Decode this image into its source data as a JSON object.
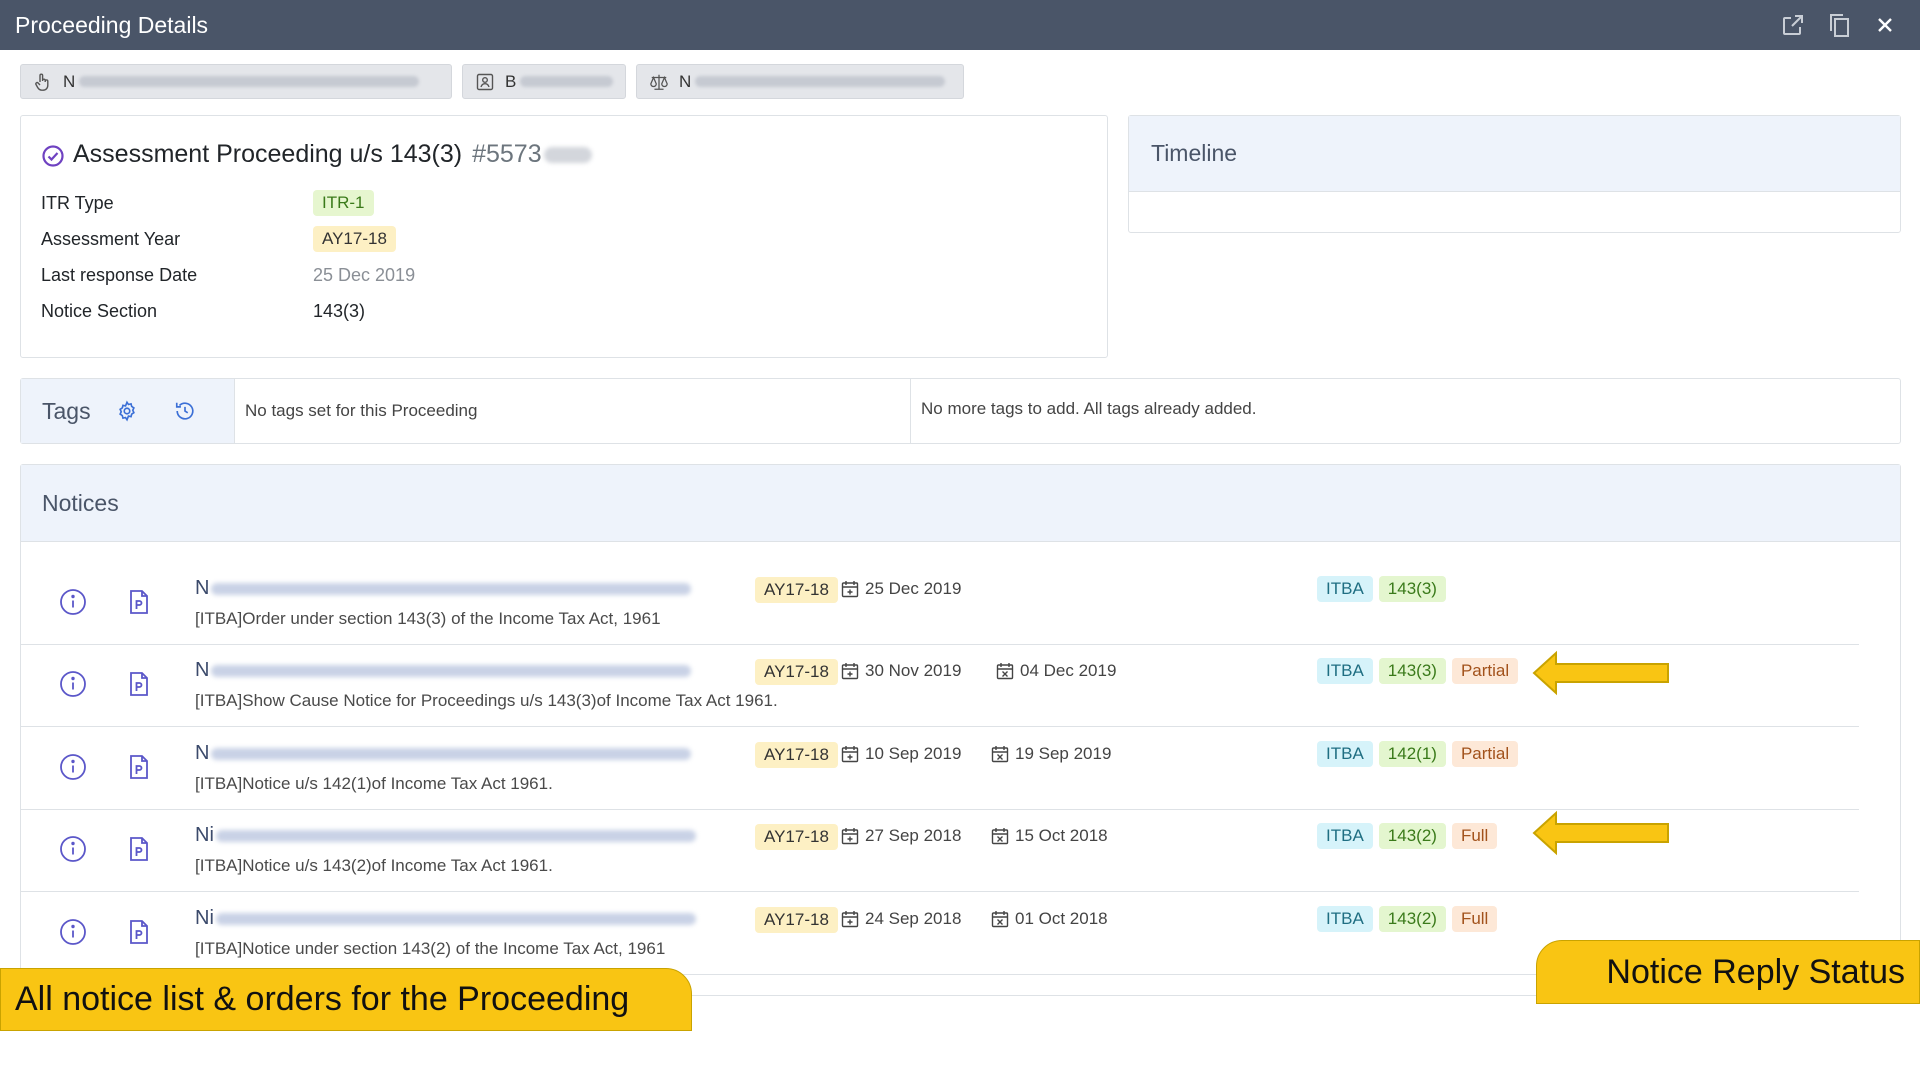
{
  "window": {
    "title": "Proceeding Details"
  },
  "chips": [
    {
      "icon": "hand-pointer-icon",
      "visible_text": "N"
    },
    {
      "icon": "id-card-icon",
      "visible_text": "B"
    },
    {
      "icon": "balance-scale-icon",
      "visible_text": "N"
    }
  ],
  "proceeding": {
    "title": "Assessment Proceeding u/s 143(3)",
    "id_visible": "#5573",
    "fields": {
      "itr_type_label": "ITR Type",
      "itr_type_value": "ITR-1",
      "ay_label": "Assessment Year",
      "ay_value": "AY17-18",
      "last_response_label": "Last response Date",
      "last_response_value": "25 Dec 2019",
      "notice_section_label": "Notice Section",
      "notice_section_value": "143(3)"
    }
  },
  "timeline": {
    "title": "Timeline"
  },
  "tags": {
    "title": "Tags",
    "current_text": "No tags set for this Proceeding",
    "available_text": "No more tags to add. All tags already added."
  },
  "notices": {
    "title": "Notices",
    "items": [
      {
        "name_visible": "N",
        "desc": "[ITBA]Order under section 143(3) of the Income Tax Act, 1961",
        "ay": "AY17-18",
        "issued": "25 Dec 2019",
        "due": null,
        "source": "ITBA",
        "section": "143(3)",
        "status": null
      },
      {
        "name_visible": "N",
        "desc": "[ITBA]Show Cause Notice for Proceedings u/s 143(3)of Income Tax Act 1961.",
        "ay": "AY17-18",
        "issued": "30 Nov 2019",
        "due": "04 Dec 2019",
        "source": "ITBA",
        "section": "143(3)",
        "status": "Partial"
      },
      {
        "name_visible": "N",
        "desc": "[ITBA]Notice u/s 142(1)of Income Tax Act 1961.",
        "ay": "AY17-18",
        "issued": "10 Sep 2019",
        "due": "19 Sep 2019",
        "source": "ITBA",
        "section": "142(1)",
        "status": "Partial"
      },
      {
        "name_visible": "Ni",
        "desc": "[ITBA]Notice u/s 143(2)of Income Tax Act 1961.",
        "ay": "AY17-18",
        "issued": "27 Sep 2018",
        "due": "15 Oct 2018",
        "source": "ITBA",
        "section": "143(2)",
        "status": "Full"
      },
      {
        "name_visible": "Ni",
        "desc": "[ITBA]Notice under section 143(2) of the Income Tax Act, 1961",
        "ay": "AY17-18",
        "issued": "24 Sep 2018",
        "due": "01 Oct 2018",
        "source": "ITBA",
        "section": "143(2)",
        "status": "Full"
      }
    ]
  },
  "callouts": {
    "left": "All notice list & orders for the Proceeding",
    "right": "Notice Reply Status"
  },
  "colors": {
    "titlebar": "#4a5568",
    "accent": "#6f42c1",
    "callout": "#f9c513",
    "panel_header": "#eef3fb"
  }
}
